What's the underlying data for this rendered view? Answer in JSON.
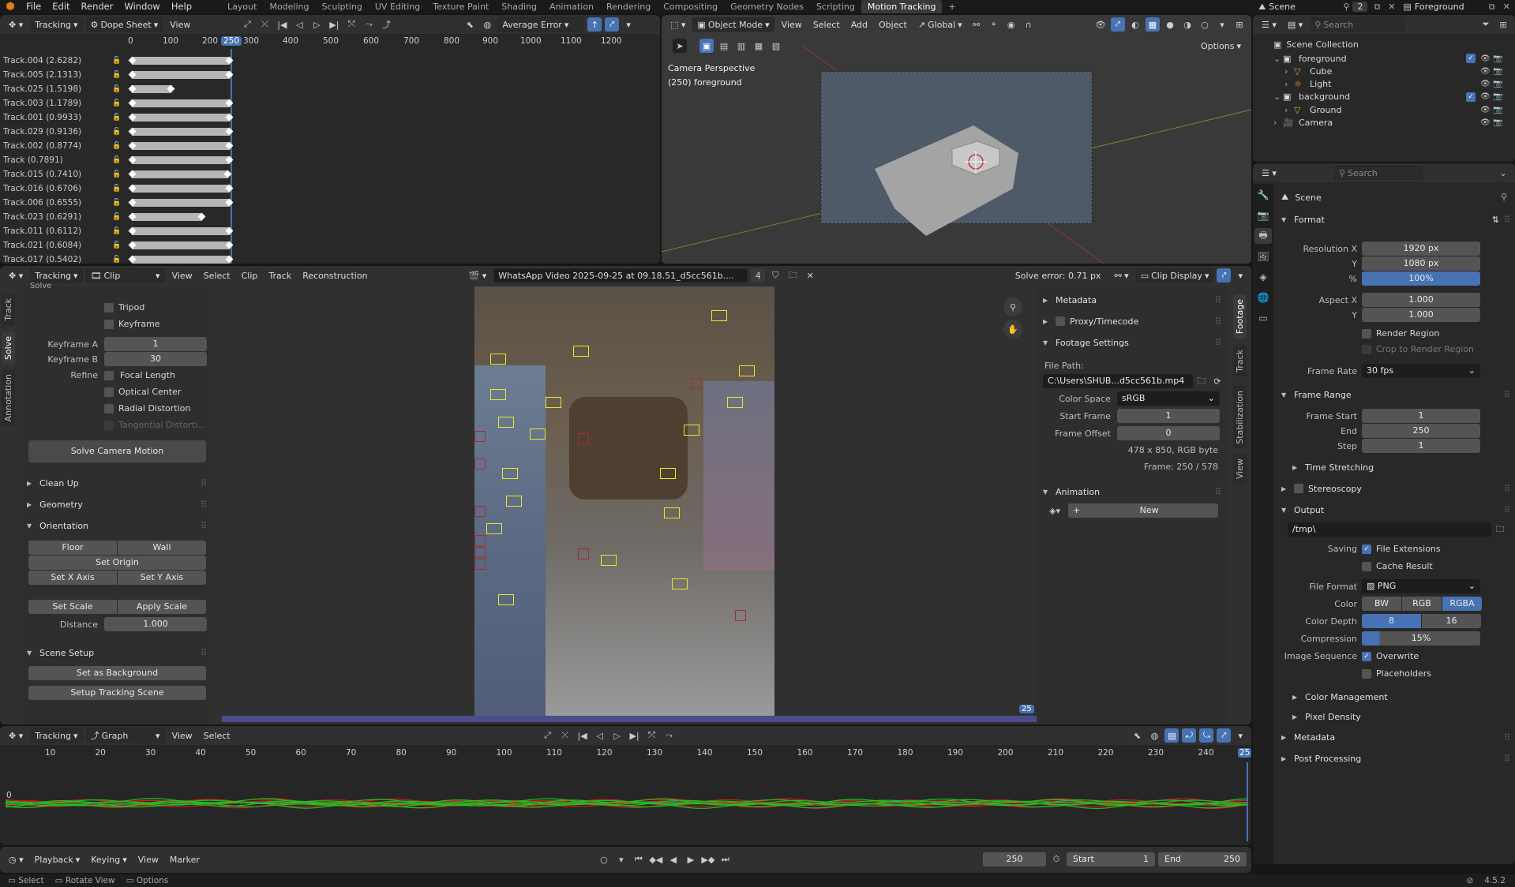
{
  "topbar": {
    "menus": [
      "File",
      "Edit",
      "Render",
      "Window",
      "Help"
    ],
    "workspaces": [
      "Layout",
      "Modeling",
      "Sculpting",
      "UV Editing",
      "Texture Paint",
      "Shading",
      "Animation",
      "Rendering",
      "Compositing",
      "Geometry Nodes",
      "Scripting",
      "Motion Tracking"
    ],
    "active_workspace": "Motion Tracking",
    "scene_label": "Scene",
    "scene_count": "2",
    "view_layer": "Foreground"
  },
  "dopesheet": {
    "mode": "Tracking",
    "editor": "Dope Sheet",
    "view_menu": "View",
    "sort": "Average Error",
    "ticks": [
      "0",
      "100",
      "200",
      "250",
      "300",
      "400",
      "500",
      "600",
      "700",
      "800",
      "900",
      "1000",
      "1100",
      "1200"
    ],
    "current_frame": "250",
    "tracks": [
      {
        "name": "Track.004 (2.6282)",
        "end": 1.0
      },
      {
        "name": "Track.005 (2.1313)",
        "end": 1.0
      },
      {
        "name": "Track.025 (1.5198)",
        "end": 0.4
      },
      {
        "name": "Track.003 (1.1789)",
        "end": 1.0
      },
      {
        "name": "Track.001 (0.9933)",
        "end": 1.0
      },
      {
        "name": "Track.029 (0.9136)",
        "end": 1.0
      },
      {
        "name": "Track.002 (0.8774)",
        "end": 1.0
      },
      {
        "name": "Track (0.7891)",
        "end": 1.0
      },
      {
        "name": "Track.015 (0.7410)",
        "end": 0.98
      },
      {
        "name": "Track.016 (0.6706)",
        "end": 1.0
      },
      {
        "name": "Track.006 (0.6555)",
        "end": 1.0
      },
      {
        "name": "Track.023 (0.6291)",
        "end": 0.72
      },
      {
        "name": "Track.011 (0.6112)",
        "end": 1.0
      },
      {
        "name": "Track.021 (0.6084)",
        "end": 1.0
      },
      {
        "name": "Track.017 (0.5402)",
        "end": 1.0
      }
    ]
  },
  "viewport": {
    "mode": "Object Mode",
    "menus": [
      "View",
      "Select",
      "Add",
      "Object"
    ],
    "transform": "Global",
    "options": "Options",
    "camera_label": "Camera Perspective",
    "collection_label": "(250) foreground"
  },
  "outliner": {
    "search_placeholder": "Search",
    "root": "Scene Collection",
    "items": [
      {
        "label": "foreground",
        "level": 1,
        "icon": "collection-icon"
      },
      {
        "label": "Cube",
        "level": 2,
        "icon": "mesh-icon"
      },
      {
        "label": "Light",
        "level": 2,
        "icon": "light-icon"
      },
      {
        "label": "background",
        "level": 1,
        "icon": "collection-icon"
      },
      {
        "label": "Ground",
        "level": 2,
        "icon": "mesh-icon"
      },
      {
        "label": "Camera",
        "level": 1,
        "icon": "camera-icon"
      }
    ]
  },
  "clip_editor": {
    "mode": "Tracking",
    "view": "Clip",
    "menus": [
      "View",
      "Select",
      "Clip",
      "Track",
      "Reconstruction"
    ],
    "clip_name": "WhatsApp Video 2025-09-25 at 09.18.51_d5cc561b....",
    "users": "4",
    "solve_error": "Solve error: 0.71 px",
    "clip_display": "Clip Display",
    "frame_badge": "25"
  },
  "solve_panel": {
    "tabs": [
      "Track",
      "Solve",
      "Annotation"
    ],
    "section": "Solve",
    "tripod": "Tripod",
    "keyframe": "Keyframe",
    "keyframe_a_label": "Keyframe A",
    "keyframe_a": "1",
    "keyframe_b_label": "Keyframe B",
    "keyframe_b": "30",
    "refine_label": "Refine",
    "refine_options": [
      "Focal Length",
      "Optical Center",
      "Radial Distortion",
      "Tangential Distorti..."
    ],
    "solve_button": "Solve Camera Motion",
    "clean_up": "Clean Up",
    "geometry": "Geometry",
    "orientation": "Orientation",
    "floor": "Floor",
    "wall": "Wall",
    "set_origin": "Set Origin",
    "set_x": "Set X Axis",
    "set_y": "Set Y Axis",
    "set_scale": "Set Scale",
    "apply_scale": "Apply Scale",
    "distance_label": "Distance",
    "distance": "1.000",
    "scene_setup": "Scene Setup",
    "set_bg": "Set as Background",
    "setup_scene": "Setup Tracking Scene"
  },
  "footage_panel": {
    "tabs": [
      "Footage",
      "Track",
      "Stabilization",
      "View"
    ],
    "metadata": "Metadata",
    "proxy": "Proxy/Timecode",
    "footage_settings": "Footage Settings",
    "file_path_label": "File Path:",
    "file_path": "C:\\Users\\SHUB...d5cc561b.mp4",
    "color_space_label": "Color Space",
    "color_space": "sRGB",
    "start_frame_label": "Start Frame",
    "start_frame": "1",
    "frame_offset_label": "Frame Offset",
    "frame_offset": "0",
    "info": "478 x 850, RGB byte",
    "frame_info": "Frame: 250 / 578",
    "animation": "Animation",
    "new": "New"
  },
  "graph": {
    "mode": "Tracking",
    "editor": "Graph",
    "menus": [
      "View",
      "Select"
    ],
    "ticks": [
      "10",
      "20",
      "30",
      "40",
      "50",
      "60",
      "70",
      "80",
      "90",
      "100",
      "110",
      "120",
      "130",
      "140",
      "150",
      "160",
      "170",
      "180",
      "190",
      "200",
      "210",
      "220",
      "230",
      "240",
      "25"
    ],
    "zero": "0"
  },
  "timeline": {
    "menus": [
      "Playback",
      "Keying",
      "View",
      "Marker"
    ],
    "current": "250",
    "start_label": "Start",
    "start": "1",
    "end_label": "End",
    "end": "250"
  },
  "properties": {
    "search_placeholder": "Search",
    "scene": "Scene",
    "format": "Format",
    "res_x_label": "Resolution X",
    "res_x": "1920 px",
    "res_y_label": "Y",
    "res_y": "1080 px",
    "pct_label": "%",
    "pct": "100%",
    "aspect_x_label": "Aspect X",
    "aspect_x": "1.000",
    "aspect_y_label": "Y",
    "aspect_y": "1.000",
    "render_region": "Render Region",
    "crop": "Crop to Render Region",
    "frame_rate_label": "Frame Rate",
    "frame_rate": "30 fps",
    "frame_range": "Frame Range",
    "frame_start_label": "Frame Start",
    "frame_start": "1",
    "end_label": "End",
    "end": "250",
    "step_label": "Step",
    "step": "1",
    "time_stretching": "Time Stretching",
    "stereoscopy": "Stereoscopy",
    "output": "Output",
    "output_path": "/tmp\\",
    "saving_label": "Saving",
    "file_extensions": "File Extensions",
    "cache_result": "Cache Result",
    "file_format_label": "File Format",
    "file_format": "PNG",
    "color_label": "Color",
    "color_opts": [
      "BW",
      "RGB",
      "RGBA"
    ],
    "depth_label": "Color Depth",
    "depth_opts": [
      "8",
      "16"
    ],
    "compression_label": "Compression",
    "compression": "15%",
    "image_seq_label": "Image Sequence",
    "overwrite": "Overwrite",
    "placeholders": "Placeholders",
    "color_mgmt": "Color Management",
    "pixel_density": "Pixel Density",
    "metadata": "Metadata",
    "post_processing": "Post Processing"
  },
  "statusbar": {
    "items": [
      "Select",
      "Rotate View",
      "Options"
    ],
    "version": "4.5.2"
  }
}
